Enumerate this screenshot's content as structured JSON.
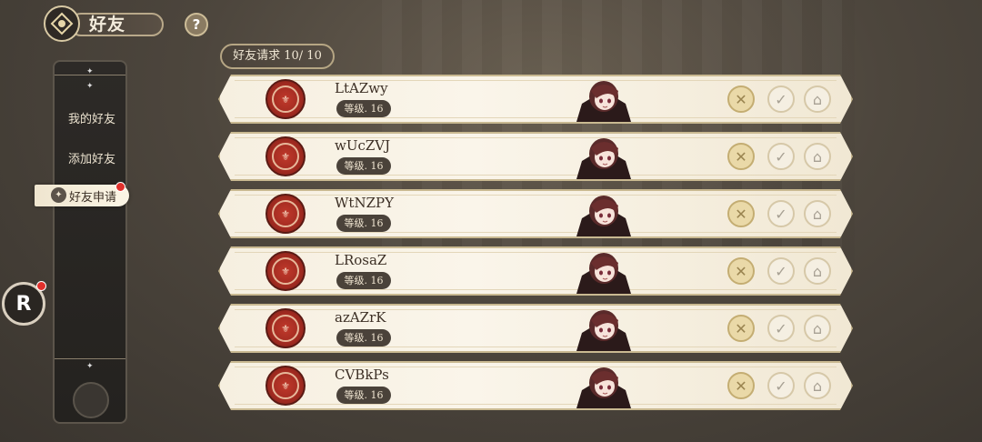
{
  "header": {
    "title": "好友",
    "help_label": "?"
  },
  "sidebar": {
    "items": [
      {
        "label": "我的好友"
      },
      {
        "label": "添加好友"
      },
      {
        "label": "好友申请"
      }
    ]
  },
  "r_button": {
    "label": "R"
  },
  "requests_tag": "好友请求 10/ 10",
  "rows": [
    {
      "name": "LtAZwy",
      "level": "等级. 16"
    },
    {
      "name": "wUcZVJ",
      "level": "等级. 16"
    },
    {
      "name": "WtNZPY",
      "level": "等级. 16"
    },
    {
      "name": "LRosaZ",
      "level": "等级. 16"
    },
    {
      "name": "azAZrK",
      "level": "等级. 16"
    },
    {
      "name": "CVBkPs",
      "level": "等级. 16"
    }
  ],
  "icons": {
    "reject": "close-icon",
    "accept": "check-icon",
    "home": "house-icon"
  },
  "colors": {
    "accent_gold": "#c9b991",
    "notification": "#e0302c",
    "avatar_red": "#c0392b"
  }
}
